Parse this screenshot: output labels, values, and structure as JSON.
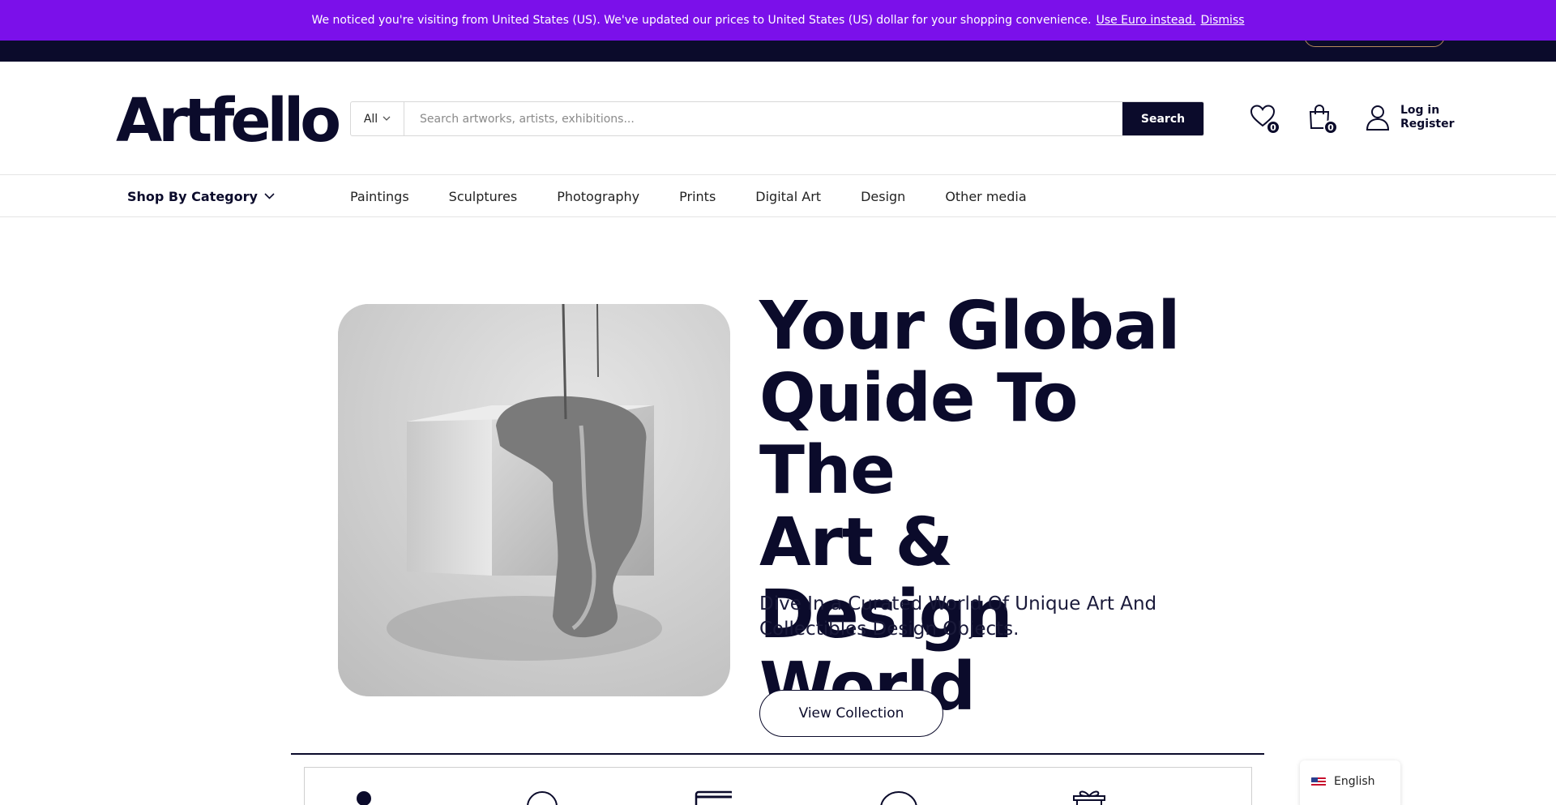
{
  "notice": {
    "message": "We noticed you're visiting from United States (US). We've updated our prices to United States (US) dollar for your shopping convenience.",
    "use_euro": "Use Euro instead.",
    "dismiss": "Dismiss"
  },
  "brand": {
    "logo_text": "Artfello"
  },
  "search": {
    "category": "All",
    "placeholder": "Search artworks, artists, exhibitions...",
    "button_label": "Search"
  },
  "header": {
    "wishlist_count": "0",
    "cart_count": "0",
    "login_label": "Log in",
    "register_label": "Register"
  },
  "nav": {
    "shop_by_category": "Shop By Category",
    "items": [
      "Paintings",
      "Sculptures",
      "Photography",
      "Prints",
      "Digital Art",
      "Design",
      "Other media"
    ]
  },
  "hero": {
    "title_lines": [
      "Your Global",
      "Quide To The",
      "Art & Design",
      "World"
    ],
    "subtitle": "Dive In a Curated World Of Unique Art And Collectibles Design Objects.",
    "cta_label": "View Collection"
  },
  "language": {
    "selected": "English"
  },
  "colors": {
    "notice_bg": "#7b10ea",
    "brand_dark": "#0b0b2b"
  },
  "icons": [
    "chevron-down-icon",
    "heart-icon",
    "shopping-bag-icon",
    "user-icon",
    "flag-us-icon",
    "gift-icon"
  ]
}
